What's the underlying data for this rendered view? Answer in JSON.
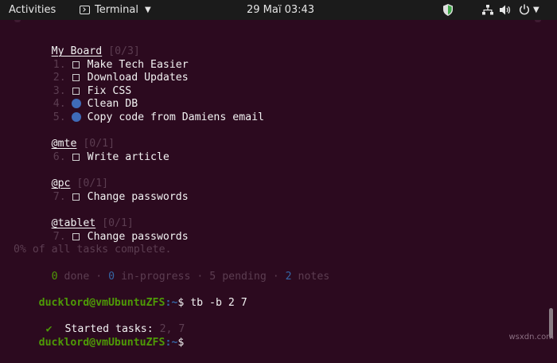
{
  "topbar": {
    "activities": "Activities",
    "app_menu": "Terminal",
    "clock": "29 Maï 03:43"
  },
  "terminal": {
    "boards": [
      {
        "title": "My Board",
        "count": "[0/3]",
        "tasks": [
          {
            "num": "1.",
            "status": "pending",
            "text": "Make Tech Easier"
          },
          {
            "num": "2.",
            "status": "pending",
            "text": "Download Updates"
          },
          {
            "num": "3.",
            "status": "pending",
            "text": "Fix CSS"
          },
          {
            "num": "4.",
            "status": "note",
            "text": "Clean DB"
          },
          {
            "num": "5.",
            "status": "note",
            "text": "Copy code from Damiens email"
          }
        ]
      },
      {
        "title": "@mte",
        "count": "[0/1]",
        "tasks": [
          {
            "num": "6.",
            "status": "pending",
            "text": "Write article"
          }
        ]
      },
      {
        "title": "@pc",
        "count": "[0/1]",
        "tasks": [
          {
            "num": "7.",
            "status": "pending",
            "text": "Change passwords"
          }
        ]
      },
      {
        "title": "@tablet",
        "count": "[0/1]",
        "tasks": [
          {
            "num": "7.",
            "status": "pending",
            "text": "Change passwords"
          }
        ]
      }
    ],
    "summary": {
      "complete": "0% of all tasks complete.",
      "done_count": "0",
      "done_label": "done",
      "inprogress_count": "0",
      "inprogress_label": "in-progress",
      "pending_count": "5",
      "pending_label": "pending",
      "notes_count": "2",
      "notes_label": "notes",
      "separator": "·"
    },
    "prompt": {
      "user": "ducklord@vmUbuntuZFS",
      "path": ":~",
      "symbol": "$"
    },
    "command": "tb -b 2 7",
    "result": {
      "check": "✔",
      "label": "Started tasks:",
      "value": "2, 7"
    }
  },
  "watermark": "wsxdn.com",
  "icons": {
    "terminal": "terminal-icon",
    "shield": "shield-icon",
    "network": "network-icon",
    "volume": "volume-icon",
    "power": "power-icon"
  },
  "colors": {
    "background": "#2c0a1f",
    "topbar": "#1b1b1b",
    "prompt_user": "#4e9a06",
    "prompt_path": "#3465a4",
    "note_dot": "#3f6bb8"
  }
}
